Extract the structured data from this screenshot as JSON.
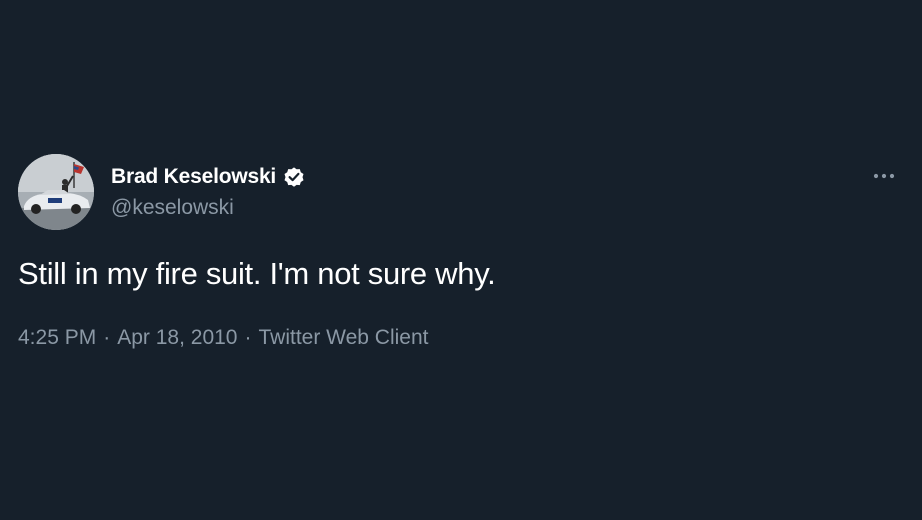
{
  "tweet": {
    "author": {
      "display_name": "Brad Keselowski",
      "handle": "@keselowski",
      "verified": true,
      "avatar_icon": "avatar-photo-car-flag-icon"
    },
    "text": "Still in my fire suit. I'm not sure why.",
    "time": "4:25 PM",
    "date": "Apr 18, 2010",
    "separator": "·",
    "source": "Twitter Web Client"
  },
  "icons": {
    "verified": "verified-badge-icon",
    "more": "more-options-icon"
  },
  "colors": {
    "background": "#16202b",
    "primary_text": "#ffffff",
    "secondary_text": "#8b98a5"
  }
}
